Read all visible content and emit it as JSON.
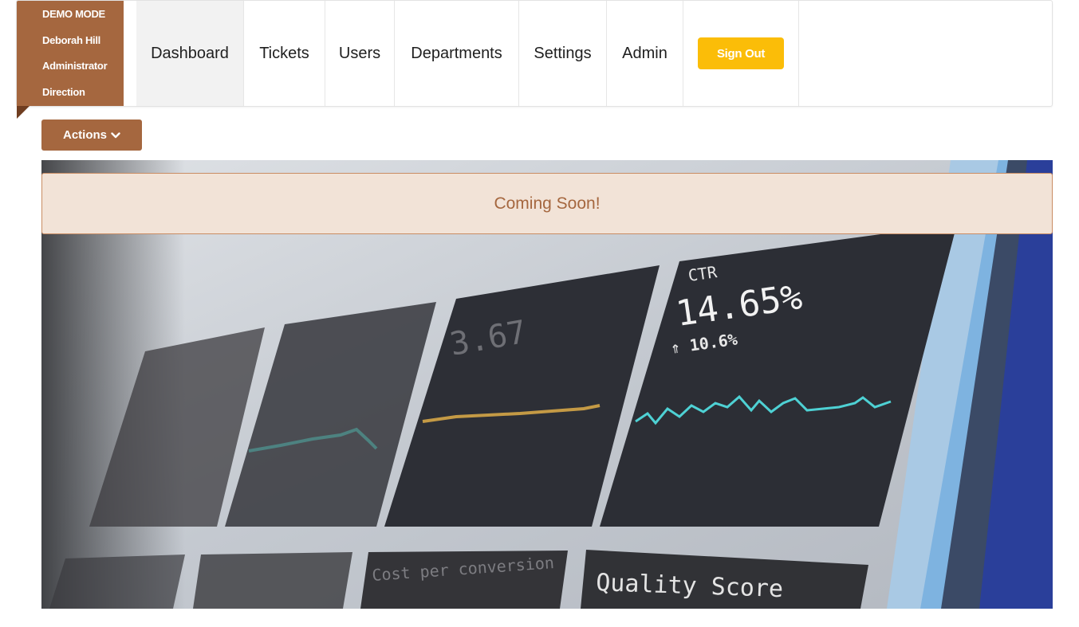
{
  "user_card": {
    "mode": "DEMO MODE",
    "name": "Deborah Hill",
    "role": "Administrator",
    "department": "Direction"
  },
  "nav": {
    "items": [
      {
        "label": "Dashboard",
        "active": true
      },
      {
        "label": "Tickets"
      },
      {
        "label": "Users"
      },
      {
        "label": "Departments"
      },
      {
        "label": "Settings"
      },
      {
        "label": "Admin"
      }
    ],
    "signout_label": "Sign Out"
  },
  "actions": {
    "label": "Actions",
    "icon": "chevron-down-icon"
  },
  "banner": {
    "message": "Coming Soon!"
  },
  "hero_image": {
    "cards": {
      "ctr_label": "CTR",
      "ctr_value": "14.65%",
      "ctr_delta": "⇑ 10.6%",
      "cpc_value": "3.67",
      "cost_per_conversion": "Cost per conversion",
      "quality_score": "Quality Score"
    }
  },
  "colors": {
    "brand": "#a5673f",
    "signout": "#fbbd08",
    "banner_bg": "#f2e3d7",
    "banner_text": "#a5673f"
  }
}
